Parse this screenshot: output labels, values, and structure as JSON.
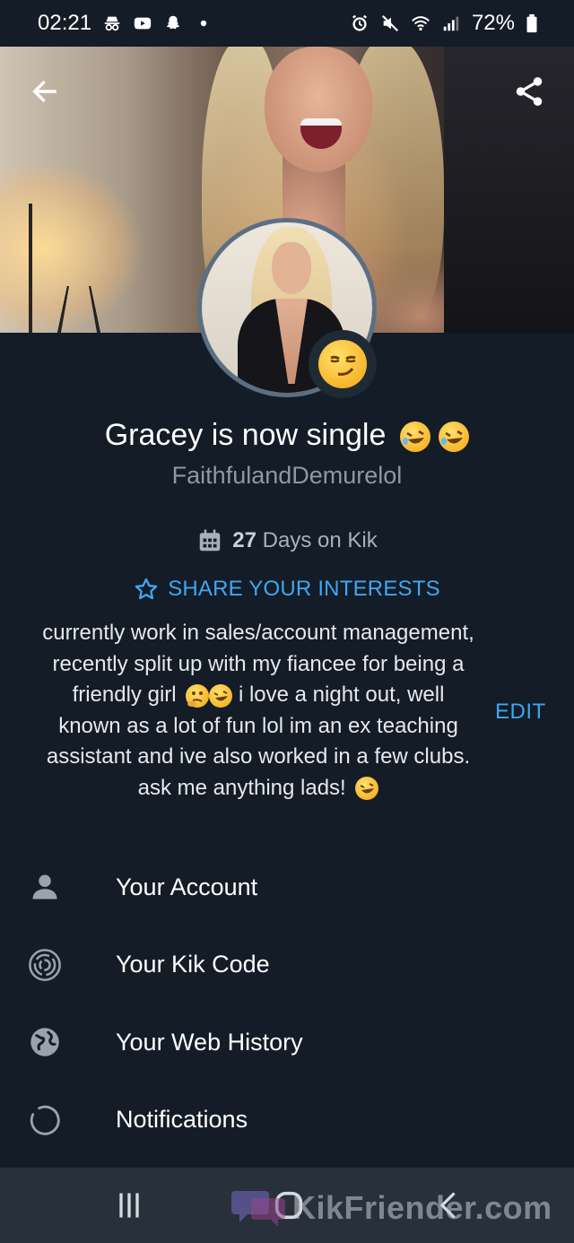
{
  "status_bar": {
    "time": "02:21",
    "battery": "72%"
  },
  "profile": {
    "display_name": "Gracey is now single",
    "username": "FaithfulandDemurelol",
    "days_count": "27",
    "days_label": "Days on Kik",
    "share_interests_label": "SHARE YOUR INTERESTS",
    "bio_lines": [
      "currently work in sales/account management,",
      "recently split up with my fiancee for being a",
      "friendly girl",
      "i love a night out, well",
      "known as a lot of fun lol  im an ex teaching",
      "assistant and ive also worked in a few clubs.",
      "ask me anything lads!"
    ],
    "edit_label": "EDIT"
  },
  "menu": {
    "items": [
      {
        "label": "Your Account",
        "icon": "person-icon"
      },
      {
        "label": "Your Kik Code",
        "icon": "kik-code-icon"
      },
      {
        "label": "Your Web History",
        "icon": "globe-icon"
      },
      {
        "label": "Notifications",
        "icon": "notification-ring-icon"
      }
    ]
  },
  "watermark": {
    "text": "KikFriender.com"
  },
  "colors": {
    "background": "#131c27",
    "accent": "#3fa7f0",
    "muted_text": "#8e98a3",
    "navbar": "#27303b"
  }
}
